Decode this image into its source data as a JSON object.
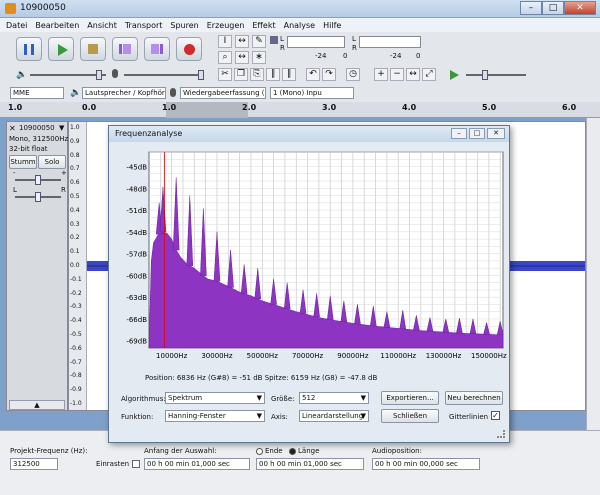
{
  "window": {
    "title": "10900050"
  },
  "menu": [
    "Datei",
    "Bearbeiten",
    "Ansicht",
    "Transport",
    "Spuren",
    "Erzeugen",
    "Effekt",
    "Analyse",
    "Hilfe"
  ],
  "meters": {
    "l_label": "L",
    "r_label": "R",
    "play_ticks": [
      "-24",
      "0"
    ],
    "rec_ticks": [
      "-24",
      "0"
    ]
  },
  "devices": {
    "host": "MME",
    "output": "Lautsprecher / Kopfhöri",
    "input": "Wiedergabeerfassung (",
    "channels": "1 (Mono) Inpu"
  },
  "ruler": {
    "ticks": [
      "1.0",
      "0.0",
      "1.0",
      "2.0",
      "3.0",
      "4.0",
      "5.0",
      "6.0"
    ]
  },
  "track": {
    "name": "10900050",
    "info": [
      "Mono, 312500Hz",
      "32-bit float"
    ],
    "mute": "Stumm",
    "solo": "Solo",
    "gain_minus": "-",
    "gain_plus": "+",
    "pan_l": "L",
    "pan_r": "R",
    "amp_ticks": [
      "1.0",
      "0.9",
      "0.8",
      "0.7",
      "0.6",
      "0.5",
      "0.4",
      "0.3",
      "0.2",
      "0.1",
      "0.0",
      "-0.1",
      "-0.2",
      "-0.3",
      "-0.4",
      "-0.5",
      "-0.6",
      "-0.7",
      "-0.8",
      "-0.9",
      "-1.0"
    ]
  },
  "bottom": {
    "rate_label": "Projekt-Frequenz (Hz):",
    "rate_value": "312500",
    "snap_label": "Einrasten",
    "sel_start_label": "Anfang der Auswahl:",
    "end_label": "Ende",
    "length_label": "Länge",
    "pos_label": "Audioposition:",
    "time1": "00 h 00 min 01,000 sec",
    "time2": "00 h 00 min 01,000 sec",
    "time3": "00 h 00 min 00,000 sec"
  },
  "dialog": {
    "title": "Frequenzanalyse",
    "status": "Position: 6836 Hz (G#8) = -51 dB   Spitze: 6159 Hz (G8) = -47.8 dB",
    "algorithm_label": "Algorithmus:",
    "algorithm_value": "Spektrum",
    "size_label": "Größe:",
    "size_value": "512",
    "export": "Exportieren...",
    "recalc": "Neu berechnen",
    "function_label": "Funktion:",
    "function_value": "Hanning-Fenster",
    "axis_label": "Axis:",
    "axis_value": "Lineardarstellung",
    "close": "Schließen",
    "grid_label": "Gitterlinien"
  },
  "chart_data": {
    "type": "area",
    "title": "",
    "xlabel": "",
    "ylabel": "",
    "x_ticks": [
      "10000Hz",
      "30000Hz",
      "50000Hz",
      "70000Hz",
      "90000Hz",
      "110000Hz",
      "130000Hz",
      "150000Hz"
    ],
    "y_ticks": [
      "-45dB",
      "-48dB",
      "-51dB",
      "-54dB",
      "-57dB",
      "-60dB",
      "-63dB",
      "-66dB",
      "-69dB"
    ],
    "xlim": [
      0,
      156250
    ],
    "ylim": [
      -70,
      -43
    ],
    "grid": true,
    "fill_color": "#8d35c2",
    "series": [
      {
        "values": [
          [
            0,
            -70
          ],
          [
            1000,
            -58
          ],
          [
            2000,
            -55.5
          ],
          [
            4000,
            -54.4
          ],
          [
            6159,
            -54
          ],
          [
            8000,
            -54.2
          ],
          [
            10000,
            -55
          ],
          [
            12000,
            -56.5
          ],
          [
            14000,
            -57.5
          ],
          [
            17000,
            -58.5
          ],
          [
            20000,
            -59
          ],
          [
            23000,
            -59.8
          ],
          [
            26000,
            -60.5
          ],
          [
            30000,
            -60.8
          ],
          [
            35000,
            -61.5
          ],
          [
            40000,
            -62.3
          ],
          [
            45000,
            -62.8
          ],
          [
            50000,
            -63.5
          ],
          [
            55000,
            -64
          ],
          [
            60000,
            -64.5
          ],
          [
            65000,
            -65
          ],
          [
            70000,
            -65.4
          ],
          [
            75000,
            -65.8
          ],
          [
            80000,
            -66.1
          ],
          [
            90000,
            -66.6
          ],
          [
            100000,
            -67
          ],
          [
            110000,
            -67.3
          ],
          [
            120000,
            -67.6
          ],
          [
            130000,
            -67.8
          ],
          [
            140000,
            -68
          ],
          [
            156250,
            -68.2
          ]
        ]
      }
    ],
    "peaks": [
      [
        4500,
        -50
      ],
      [
        6159,
        -47.8
      ],
      [
        12000,
        -46.5
      ],
      [
        18000,
        -49
      ],
      [
        24000,
        -50.8
      ],
      [
        30000,
        -54
      ],
      [
        36000,
        -56.5
      ],
      [
        42000,
        -58.5
      ],
      [
        48000,
        -59
      ],
      [
        55000,
        -60.5
      ],
      [
        61000,
        -61
      ],
      [
        68000,
        -62
      ],
      [
        74000,
        -62.5
      ],
      [
        80000,
        -62.8
      ],
      [
        86000,
        -63.5
      ],
      [
        92000,
        -64
      ],
      [
        99000,
        -64.2
      ],
      [
        105000,
        -65
      ],
      [
        112000,
        -64.8
      ],
      [
        118000,
        -65.5
      ],
      [
        124000,
        -65.8
      ],
      [
        131000,
        -66
      ],
      [
        137000,
        -65.9
      ],
      [
        143000,
        -66
      ],
      [
        149000,
        -66.5
      ],
      [
        155000,
        -66.3
      ]
    ]
  }
}
